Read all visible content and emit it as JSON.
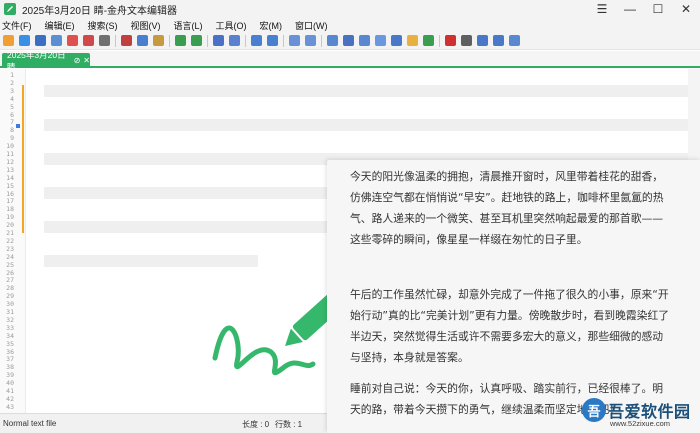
{
  "window": {
    "title": "2025年3月20日 睛-金舟文本编辑器",
    "minimize_glyph": "—",
    "maximize_glyph": "☐",
    "close_glyph": "✕",
    "menu_glyph": "☰"
  },
  "menubar": {
    "items": [
      "文件(F)",
      "编辑(E)",
      "搜索(S)",
      "视图(V)",
      "语言(L)",
      "工具(O)",
      "宏(M)",
      "窗口(W)"
    ]
  },
  "toolbar": {
    "icons": [
      {
        "name": "new-file-icon",
        "color": "#f0a030"
      },
      {
        "name": "open-file-icon",
        "color": "#3a8ee6"
      },
      {
        "name": "save-icon",
        "color": "#3a6fc4"
      },
      {
        "name": "save-all-icon",
        "color": "#5a8fd4"
      },
      {
        "name": "close-file-icon",
        "color": "#e05050"
      },
      {
        "name": "close-all-icon",
        "color": "#d04848"
      },
      {
        "name": "print-icon",
        "color": "#707070"
      },
      {
        "name": "sep"
      },
      {
        "name": "cut-icon",
        "color": "#c04040"
      },
      {
        "name": "copy-icon",
        "color": "#4a7fd0"
      },
      {
        "name": "paste-icon",
        "color": "#c89a40"
      },
      {
        "name": "sep"
      },
      {
        "name": "undo-icon",
        "color": "#3a9e50"
      },
      {
        "name": "redo-icon",
        "color": "#3a9e50"
      },
      {
        "name": "sep"
      },
      {
        "name": "find-icon",
        "color": "#4a70c8"
      },
      {
        "name": "replace-icon",
        "color": "#5a80d0"
      },
      {
        "name": "sep"
      },
      {
        "name": "zoom-in-icon",
        "color": "#4a80d0"
      },
      {
        "name": "zoom-out-icon",
        "color": "#4a80d0"
      },
      {
        "name": "sep"
      },
      {
        "name": "sync-scroll-v-icon",
        "color": "#6a90d8"
      },
      {
        "name": "sync-scroll-h-icon",
        "color": "#6a90d8"
      },
      {
        "name": "sep"
      },
      {
        "name": "word-wrap-icon",
        "color": "#5a88d0"
      },
      {
        "name": "show-all-chars-icon",
        "color": "#4a70c0"
      },
      {
        "name": "indent-guide-icon",
        "color": "#5a88d0"
      },
      {
        "name": "doc-map-icon",
        "color": "#6a98e0"
      },
      {
        "name": "function-list-icon",
        "color": "#4a78c8"
      },
      {
        "name": "folder-workspace-icon",
        "color": "#e8b040"
      },
      {
        "name": "monitor-icon",
        "color": "#3a9e50"
      },
      {
        "name": "sep"
      },
      {
        "name": "record-macro-icon",
        "color": "#d03030"
      },
      {
        "name": "stop-macro-icon",
        "color": "#606060"
      },
      {
        "name": "play-macro-icon",
        "color": "#4a78c8"
      },
      {
        "name": "run-macro-multiple-icon",
        "color": "#4a78c8"
      },
      {
        "name": "save-macro-icon",
        "color": "#5a88d0"
      }
    ]
  },
  "tab": {
    "label": "2025年3月20日 睛",
    "pin_glyph": "⊘",
    "close_glyph": "✕"
  },
  "gutter": {
    "line_numbers": [
      "1",
      "2",
      "3",
      "4",
      "5",
      "6",
      "7",
      "8",
      "9",
      "10",
      "11",
      "12",
      "13",
      "14",
      "15",
      "16",
      "17",
      "18",
      "19",
      "20",
      "21",
      "22",
      "23",
      "24",
      "25",
      "26",
      "27",
      "28",
      "29",
      "30",
      "31",
      "32",
      "33",
      "34",
      "35",
      "36",
      "37",
      "38",
      "39",
      "40",
      "41",
      "42",
      "43"
    ]
  },
  "statusbar": {
    "file_type": "Normal text file",
    "length": "长度 : 0",
    "lines": "行数 : 1"
  },
  "preview": {
    "paragraphs": [
      {
        "lines": [
          "今天的阳光像温柔的拥抱，清晨推开窗时，风里带着桂花的甜香，",
          "仿佛连空气都在悄悄说“早安”。赶地铁的路上，咖啡杯里氤氲的热",
          "气、路人递来的一个微笑、甚至耳机里突然响起最爱的那首歌——",
          "这些零碎的瞬间，像星星一样缀在匆忙的日子里。"
        ]
      },
      {
        "lines": [
          "午后的工作虽然忙碌，却意外完成了一件拖了很久的小事，原来“开",
          "始行动”真的比“完美计划”更有力量。傍晚散步时，看到晚霞染红了",
          "半边天，突然觉得生活或许不需要多宏大的意义，那些细微的感动",
          "与坚持，本身就是答案。"
        ]
      },
      {
        "lines": [
          "睡前对自己说：今天的你，认真呼吸、踏实前行，已经很棒了。明",
          "天的路，带着今天攒下的勇气，继续温柔而坚定地走吧！"
        ]
      }
    ]
  },
  "watermark": {
    "name": "吾爱软件园",
    "url": "www.52zixue.com",
    "logo_char": "吾"
  },
  "colors": {
    "accent_green": "#2fae63",
    "change_bar": "#f5a623",
    "bookmark_blue": "#3d7be0",
    "pen_green": "#35b86b"
  }
}
